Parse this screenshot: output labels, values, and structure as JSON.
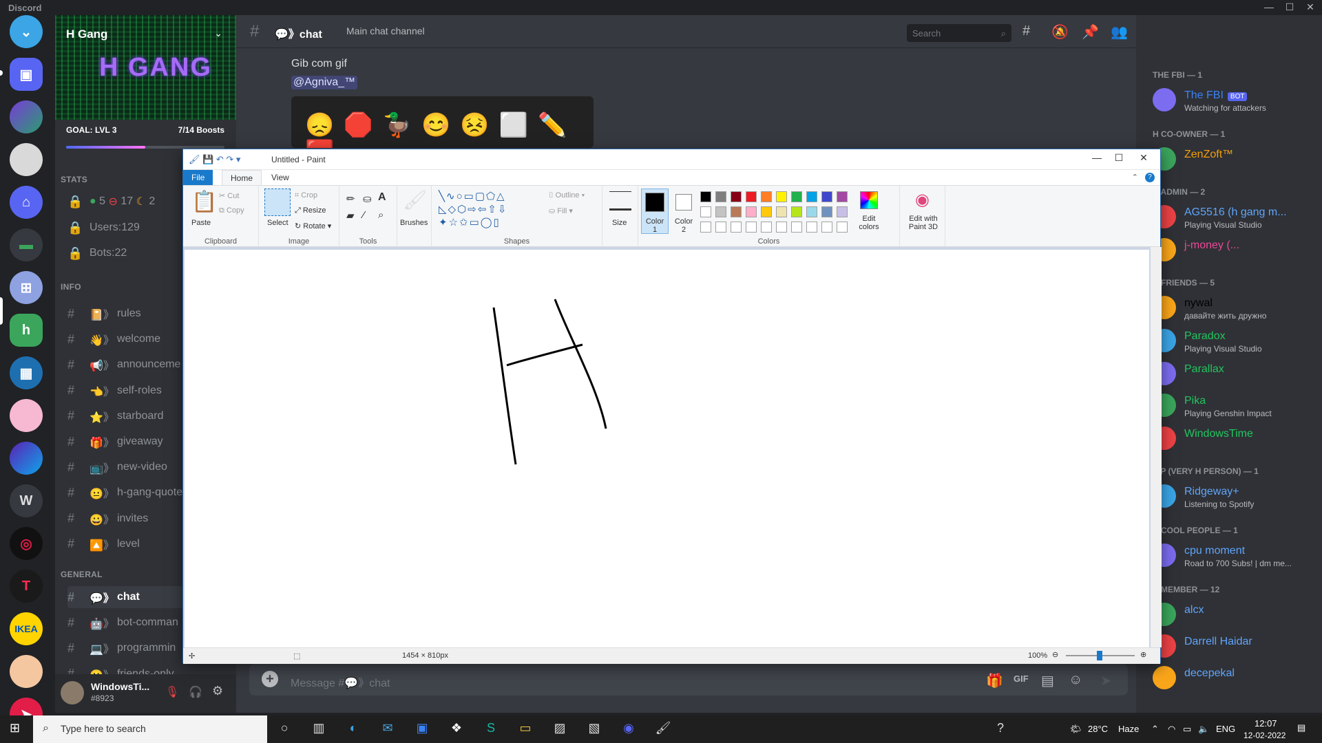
{
  "app": {
    "name": "Discord"
  },
  "guild": {
    "name": "H Gang",
    "banner_text": "H GANG",
    "goal": "GOAL: LVL 3",
    "boosts": "7/14 Boosts",
    "goal_progress": 0.5
  },
  "categories": {
    "stats": "STATS",
    "info": "INFO",
    "general": "GENERAL"
  },
  "stats": {
    "online": "5",
    "dnd": "17",
    "idle": "2",
    "users": "Users:129",
    "bots": "Bots:22"
  },
  "info_channels": [
    {
      "emoji": "📔",
      "name": "rules"
    },
    {
      "emoji": "👋",
      "name": "welcome"
    },
    {
      "emoji": "📢",
      "name": "announceme"
    },
    {
      "emoji": "👈",
      "name": "self-roles"
    },
    {
      "emoji": "⭐",
      "name": "starboard"
    },
    {
      "emoji": "🎁",
      "name": "giveaway"
    },
    {
      "emoji": "📺",
      "name": "new-video"
    },
    {
      "emoji": "😐",
      "name": "h-gang-quote"
    },
    {
      "emoji": "😀",
      "name": "invites"
    },
    {
      "emoji": "🔼",
      "name": "level"
    }
  ],
  "general_channels": [
    {
      "emoji": "💬",
      "name": "chat"
    },
    {
      "emoji": "🤖",
      "name": "bot-comman"
    },
    {
      "emoji": "💻",
      "name": "programmin"
    },
    {
      "emoji": "😀",
      "name": "friends-only"
    }
  ],
  "user": {
    "name": "WindowsTi...",
    "tag": "#8923"
  },
  "header": {
    "channel": "💬》chat",
    "topic": "Main chat channel",
    "search_placeholder": "Search"
  },
  "messages": {
    "line1": "Gib com gif",
    "mention": "@Agniva_™"
  },
  "composer": {
    "placeholder": "Message #💬》chat"
  },
  "members": {
    "groups": [
      {
        "label": "THE FBI — 1",
        "members": [
          {
            "name": "The FBI",
            "badge": "BOT",
            "status": "Watching for attackers",
            "color": "#3b82f6"
          }
        ]
      },
      {
        "label": "H CO-OWNER — 1",
        "members": [
          {
            "name": "ZenZoft™",
            "status": "",
            "color": "#f59e0b"
          }
        ]
      },
      {
        "label": "H ADMIN — 2",
        "members": [
          {
            "name": "AG5516 (h gang m...",
            "status": "Playing Visual Studio",
            "color": "#60a5fa"
          },
          {
            "name": "j-money (...",
            "status": "",
            "color": "#ec4899"
          }
        ]
      },
      {
        "label": "H FRIENDS — 5",
        "members": [
          {
            "name": "nywal",
            "status": "давайте жить дружно",
            "color": "#000000"
          },
          {
            "name": "Paradox",
            "status": "Playing Visual Studio",
            "color": "#22c55e"
          },
          {
            "name": "Parallax",
            "status": "",
            "color": "#22c55e"
          },
          {
            "name": "Pika",
            "status": "Playing Genshin Impact",
            "color": "#22c55e"
          },
          {
            "name": "WindowsTime",
            "status": "",
            "color": "#22c55e"
          }
        ]
      },
      {
        "label": "VIP (VERY H PERSON) — 1",
        "members": [
          {
            "name": "Ridgeway+",
            "status": "Listening to Spotify",
            "color": "#60a5fa"
          }
        ]
      },
      {
        "label": "H COOL PEOPLE — 1",
        "members": [
          {
            "name": "cpu moment",
            "status": "Road to 700 Subs! | dm me...",
            "color": "#60a5fa"
          }
        ]
      },
      {
        "label": "H MEMBER — 12",
        "members": [
          {
            "name": "alcx",
            "status": "",
            "color": "#60a5fa"
          },
          {
            "name": "Darrell Haidar",
            "status": "",
            "color": "#60a5fa"
          },
          {
            "name": "decepekal",
            "status": "",
            "color": "#60a5fa"
          }
        ]
      }
    ]
  },
  "paint": {
    "title": "Untitled - Paint",
    "tabs": [
      "File",
      "Home",
      "View"
    ],
    "clipboard": {
      "paste": "Paste",
      "cut": "Cut",
      "copy": "Copy",
      "label": "Clipboard"
    },
    "image": {
      "select": "Select",
      "crop": "Crop",
      "resize": "Resize",
      "rotate": "Rotate",
      "label": "Image"
    },
    "tools": {
      "label": "Tools"
    },
    "brushes": "Brushes",
    "shapes": {
      "label": "Shapes",
      "outline": "Outline",
      "fill": "Fill"
    },
    "size": "Size",
    "color1": "Color 1",
    "color2": "Color 2",
    "colors_label": "Colors",
    "edit_colors": "Edit colors",
    "edit_paint3d": "Edit with Paint 3D",
    "palette_row1": [
      "#000000",
      "#7f7f7f",
      "#880015",
      "#ed1c24",
      "#ff7f27",
      "#fff200",
      "#22b14c",
      "#00a2e8",
      "#3f48cc",
      "#a349a4"
    ],
    "palette_row2": [
      "#ffffff",
      "#c3c3c3",
      "#b97a57",
      "#ffaec9",
      "#ffc90e",
      "#efe4b0",
      "#b5e61d",
      "#99d9ea",
      "#7092be",
      "#c8bfe7"
    ],
    "status_size": "1454 × 810px",
    "zoom": "100%"
  },
  "taskbar": {
    "search_placeholder": "Type here to search",
    "temp": "28°C",
    "weather": "Haze",
    "lang": "ENG",
    "time": "12:07",
    "date": "12-02-2022"
  }
}
